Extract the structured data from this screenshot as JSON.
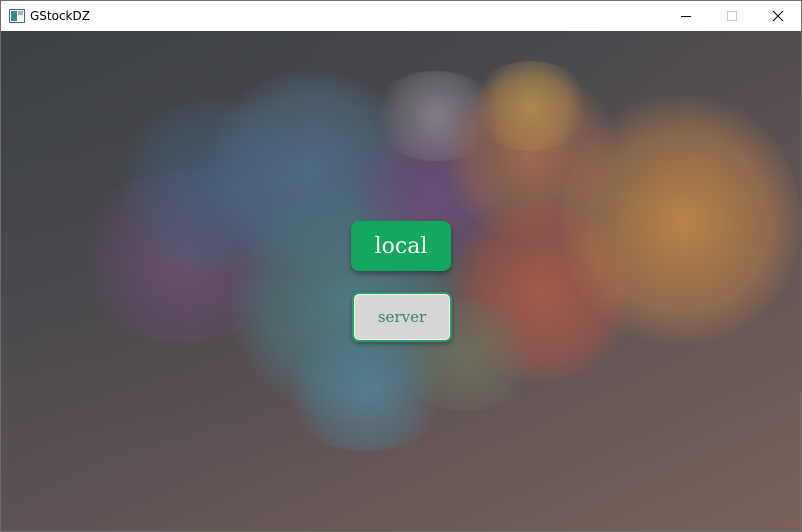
{
  "window": {
    "title": "GStockDZ"
  },
  "buttons": {
    "local_label": "local",
    "server_label": "server"
  },
  "colors": {
    "local_button": "#14a85f",
    "server_button_bg": "#d6d6d6",
    "server_button_text": "#2a8a58"
  },
  "icons": [
    "app-icon",
    "minimize-icon",
    "maximize-icon",
    "close-icon"
  ]
}
